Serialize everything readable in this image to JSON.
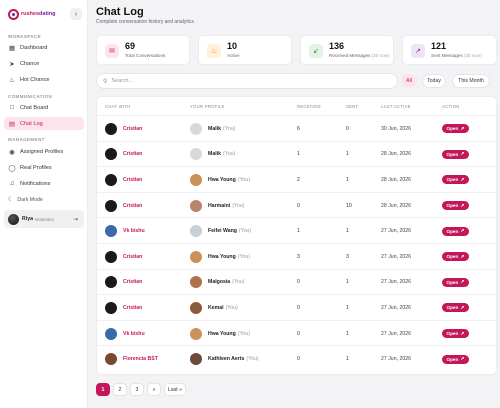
{
  "brand": {
    "part1": "rushes",
    "part2": "dating"
  },
  "sidebar": {
    "collapse_icon": "chevron-left-icon",
    "sections": [
      {
        "label": "WORKSPACE"
      },
      {
        "label": "COMMUNICATION"
      },
      {
        "label": "MANAGEMENT"
      }
    ],
    "items": [
      {
        "label": "Dashboard",
        "icon": "grid-icon"
      },
      {
        "label": "Chance",
        "icon": "paper-plane-icon"
      },
      {
        "label": "Hot Chance",
        "icon": "flame-icon"
      },
      {
        "label": "Chat Board",
        "icon": "chat-bubble-icon"
      },
      {
        "label": "Chat Log",
        "icon": "clipboard-icon",
        "active": true
      },
      {
        "label": "Assigned Profiles",
        "icon": "users-icon"
      },
      {
        "label": "Real Profiles",
        "icon": "user-icon"
      },
      {
        "label": "Notifications",
        "icon": "bell-icon"
      }
    ],
    "dark_mode_label": "Dark Mode",
    "user": {
      "name": "Riya",
      "role": "Moderator"
    }
  },
  "header": {
    "title": "Chat Log",
    "subtitle": "Complete conversation history and analytics"
  },
  "stats": [
    {
      "value": "69",
      "label": "Total Conversations",
      "note": "",
      "icon": "chat-icon",
      "color": "#c2185b",
      "bg": "#fde4ec"
    },
    {
      "value": "10",
      "label": "Active",
      "note": "",
      "icon": "flame-icon",
      "color": "#f57c00",
      "bg": "#fff2db"
    },
    {
      "value": "136",
      "label": "Received Messages",
      "note": "(30 now)",
      "icon": "arrow-down-left-icon",
      "color": "#2e7d32",
      "bg": "#e1f4e4"
    },
    {
      "value": "121",
      "label": "Sent Messages",
      "note": "(30 now)",
      "icon": "arrow-up-right-icon",
      "color": "#7b1fa2",
      "bg": "#efe3f6"
    }
  ],
  "search": {
    "placeholder": "Search..."
  },
  "filters": [
    {
      "label": "All",
      "active": true
    },
    {
      "label": "Today",
      "active": false
    },
    {
      "label": "This Month",
      "active": false
    }
  ],
  "table": {
    "columns": [
      "CHAT WITH",
      "YOUR PROFILE",
      "RECEIVED",
      "SENT",
      "LAST ACTIVE",
      "ACTION"
    ],
    "you_label": "(You)",
    "action_label": "Open",
    "rows": [
      {
        "chat_with": "Cristian",
        "profile": "Malik",
        "received": "6",
        "sent": "0",
        "last_active": "30 Jun, 2026"
      },
      {
        "chat_with": "Cristian",
        "profile": "Malik",
        "received": "1",
        "sent": "1",
        "last_active": "28 Jun, 2026"
      },
      {
        "chat_with": "Cristian",
        "profile": "Hwa Young",
        "received": "2",
        "sent": "1",
        "last_active": "28 Jun, 2026"
      },
      {
        "chat_with": "Cristian",
        "profile": "Harmaini",
        "received": "0",
        "sent": "10",
        "last_active": "28 Jun, 2026"
      },
      {
        "chat_with": "Vk bishu",
        "profile": "Feifei Wang",
        "received": "1",
        "sent": "1",
        "last_active": "27 Jun, 2026"
      },
      {
        "chat_with": "Cristian",
        "profile": "Hwa Young",
        "received": "3",
        "sent": "3",
        "last_active": "27 Jun, 2026"
      },
      {
        "chat_with": "Cristian",
        "profile": "Malgosia",
        "received": "0",
        "sent": "1",
        "last_active": "27 Jun, 2026"
      },
      {
        "chat_with": "Cristian",
        "profile": "Kemal",
        "received": "0",
        "sent": "1",
        "last_active": "27 Jun, 2026"
      },
      {
        "chat_with": "Vk bishu",
        "profile": "Hwa Young",
        "received": "0",
        "sent": "1",
        "last_active": "27 Jun, 2026"
      },
      {
        "chat_with": "Florencia BST",
        "profile": "Kathleen Aerts",
        "received": "0",
        "sent": "1",
        "last_active": "27 Jun, 2026"
      }
    ]
  },
  "pagination": {
    "pages": [
      "1",
      "2",
      "3",
      "»",
      "Last »"
    ],
    "current": "1"
  },
  "colors": {
    "accent": "#c2185b",
    "accent_soft": "#fde4ec"
  }
}
